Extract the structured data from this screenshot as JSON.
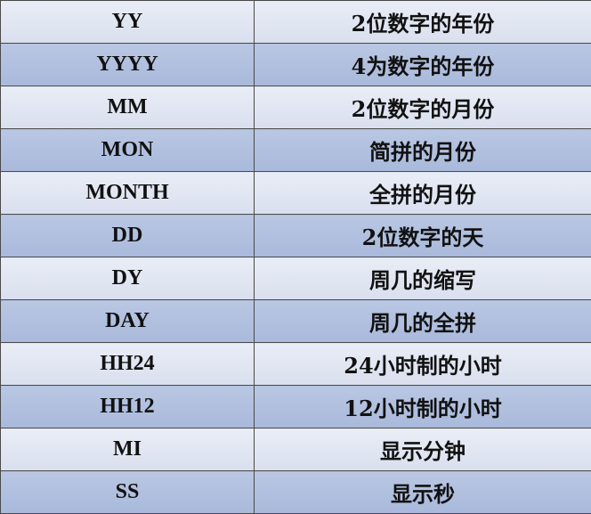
{
  "table": {
    "rows": [
      {
        "code": "YY",
        "desc": "2位数字的年份"
      },
      {
        "code": "YYYY",
        "desc": "4为数字的年份"
      },
      {
        "code": "MM",
        "desc": "2位数字的月份"
      },
      {
        "code": "MON",
        "desc": "简拼的月份"
      },
      {
        "code": "MONTH",
        "desc": "全拼的月份"
      },
      {
        "code": "DD",
        "desc": "2位数字的天"
      },
      {
        "code": "DY",
        "desc": "周几的缩写"
      },
      {
        "code": "DAY",
        "desc": "周几的全拼"
      },
      {
        "code": "HH24",
        "desc": "24小时制的小时"
      },
      {
        "code": "HH12",
        "desc": "12小时制的小时"
      },
      {
        "code": "MI",
        "desc": "显示分钟"
      },
      {
        "code": "SS",
        "desc": "显示秒"
      }
    ]
  },
  "colors": {
    "odd_row": "#dfe4f1",
    "even_row": "#b1c0df",
    "border": "#4a4a4a",
    "text": "#111111"
  }
}
